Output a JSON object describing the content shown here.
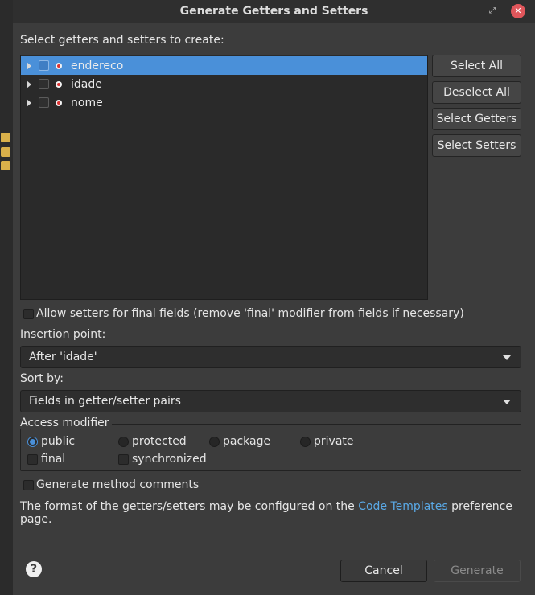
{
  "window": {
    "title": "Generate Getters and Setters"
  },
  "labels": {
    "select_prompt": "Select getters and setters to create:",
    "allow_final": "Allow setters for final fields (remove 'final' modifier from fields if necessary)",
    "insertion_point": "Insertion point:",
    "sort_by": "Sort by:",
    "access_modifier": "Access modifier",
    "generate_comments": "Generate method comments",
    "format_prefix": "The format of the getters/setters may be configured on the ",
    "format_link": "Code Templates",
    "format_suffix": " preference page."
  },
  "tree": {
    "items": [
      {
        "label": "endereco",
        "selected": true
      },
      {
        "label": "idade",
        "selected": false
      },
      {
        "label": "nome",
        "selected": false
      }
    ]
  },
  "side_buttons": {
    "select_all": "Select All",
    "deselect_all": "Deselect All",
    "select_getters": "Select Getters",
    "select_setters": "Select Setters"
  },
  "insertion": {
    "value": "After 'idade'"
  },
  "sort": {
    "value": "Fields in getter/setter pairs"
  },
  "access": {
    "options": [
      "public",
      "protected",
      "package",
      "private"
    ],
    "selected": "public",
    "final": "final",
    "synchronized": "synchronized"
  },
  "footer": {
    "help": "?",
    "cancel": "Cancel",
    "generate": "Generate"
  },
  "colors": {
    "accent": "#4a90d9",
    "close": "#e0565b",
    "link": "#5aa9e6"
  }
}
